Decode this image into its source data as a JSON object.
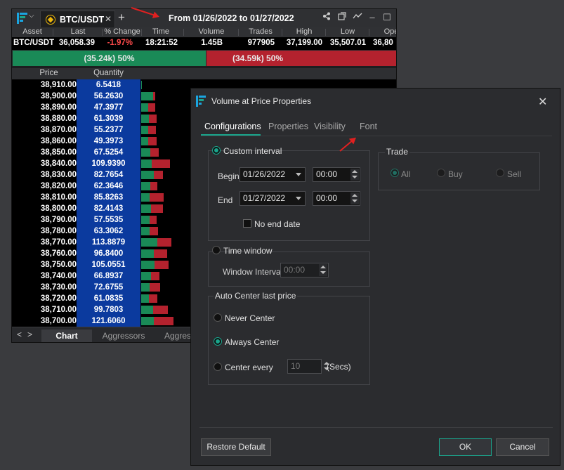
{
  "main": {
    "tab_label": "BTC/USDT",
    "tab_close": "✕",
    "add_tab": "+",
    "range_title": "From 01/26/2022 to 01/27/2022",
    "columns": [
      "Asset",
      "Last",
      "% Change",
      "Time",
      "Volume",
      "Trades",
      "High",
      "Low",
      "Ope"
    ],
    "quote": {
      "asset": "BTC/USDT",
      "last": "36,058.39",
      "change": "-1.97%",
      "time": "18:21:52",
      "volume": "1.45B",
      "trades": "977905",
      "high": "37,199.00",
      "low": "35,507.01",
      "open": "36,80"
    },
    "buy_bar": "(35.24k) 50%",
    "sell_bar": "(34.59k) 50%",
    "ladder_headers": {
      "price": "Price",
      "quantity": "Quantity"
    },
    "ladder": [
      {
        "price": "38,910.00",
        "qty": "6.5418",
        "buy": 1,
        "sell": 0
      },
      {
        "price": "38,900.00",
        "qty": "56.2630",
        "buy": 17,
        "sell": 3
      },
      {
        "price": "38,890.00",
        "qty": "47.3977",
        "buy": 10,
        "sell": 10
      },
      {
        "price": "38,880.00",
        "qty": "61.3039",
        "buy": 11,
        "sell": 11
      },
      {
        "price": "38,870.00",
        "qty": "55.2377",
        "buy": 10,
        "sell": 11
      },
      {
        "price": "38,860.00",
        "qty": "49.3973",
        "buy": 10,
        "sell": 12
      },
      {
        "price": "38,850.00",
        "qty": "67.5254",
        "buy": 13,
        "sell": 12
      },
      {
        "price": "38,840.00",
        "qty": "109.9390",
        "buy": 15,
        "sell": 26
      },
      {
        "price": "38,830.00",
        "qty": "82.7654",
        "buy": 18,
        "sell": 13
      },
      {
        "price": "38,820.00",
        "qty": "62.3646",
        "buy": 13,
        "sell": 10
      },
      {
        "price": "38,810.00",
        "qty": "85.8263",
        "buy": 12,
        "sell": 20
      },
      {
        "price": "38,800.00",
        "qty": "82.4143",
        "buy": 14,
        "sell": 17
      },
      {
        "price": "38,790.00",
        "qty": "57.5535",
        "buy": 12,
        "sell": 10
      },
      {
        "price": "38,780.00",
        "qty": "63.3062",
        "buy": 12,
        "sell": 12
      },
      {
        "price": "38,770.00",
        "qty": "113.8879",
        "buy": 23,
        "sell": 20
      },
      {
        "price": "38,760.00",
        "qty": "96.8400",
        "buy": 18,
        "sell": 19
      },
      {
        "price": "38,750.00",
        "qty": "105.0551",
        "buy": 19,
        "sell": 20
      },
      {
        "price": "38,740.00",
        "qty": "66.8937",
        "buy": 14,
        "sell": 12
      },
      {
        "price": "38,730.00",
        "qty": "72.6755",
        "buy": 12,
        "sell": 15
      },
      {
        "price": "38,720.00",
        "qty": "61.0835",
        "buy": 11,
        "sell": 12
      },
      {
        "price": "38,710.00",
        "qty": "99.7803",
        "buy": 17,
        "sell": 21
      },
      {
        "price": "38,700.00",
        "qty": "121.6060",
        "buy": 18,
        "sell": 28
      }
    ],
    "bottom_tabs": [
      "Chart",
      "Aggressors",
      "Aggress"
    ],
    "nav_prev": "<",
    "nav_next": ">",
    "colors": {
      "buy": "#1a8a57",
      "sell": "#b4222e",
      "qty_bg": "#0b3a9e"
    }
  },
  "dialog": {
    "title": "Volume at Price Properties",
    "close": "✕",
    "tabs": [
      "Configurations",
      "Properties",
      "Visibility",
      "Font"
    ],
    "custom_interval": "Custom interval",
    "begin_label": "Begin",
    "begin_date": "01/26/2022",
    "begin_time": "00:00",
    "end_label": "End",
    "end_date": "01/27/2022",
    "end_time": "00:00",
    "no_end_date": "No end date",
    "time_window": "Time window",
    "window_interval": "Window Interval",
    "window_value": "00:00",
    "auto_center": "Auto Center last price",
    "never_center": "Never Center",
    "always_center": "Always Center",
    "center_every": "Center every",
    "center_secs_value": "10",
    "secs": "(Secs)",
    "trade": "Trade",
    "trade_all": "All",
    "trade_buy": "Buy",
    "trade_sell": "Sell",
    "restore": "Restore Default",
    "ok": "OK",
    "cancel": "Cancel",
    "accent": "#1aa58c"
  }
}
